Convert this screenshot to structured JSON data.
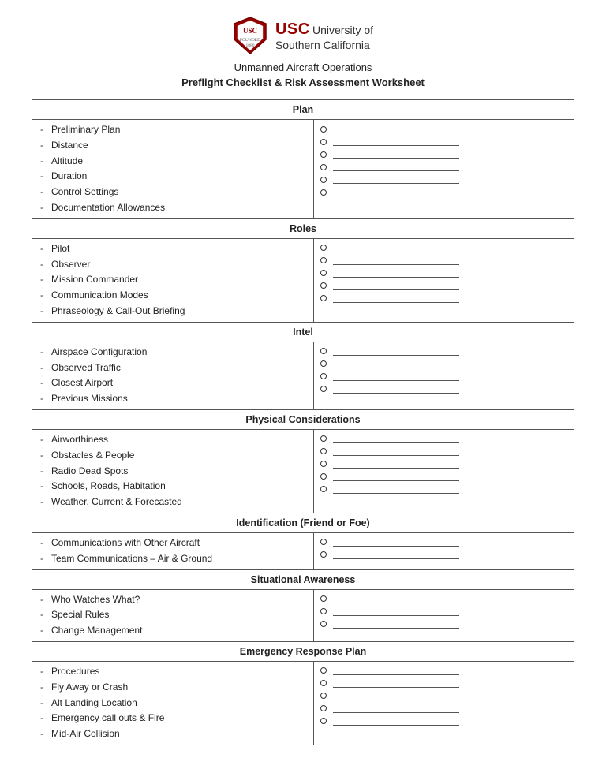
{
  "header": {
    "usc_bold": "USC",
    "usc_name1": "University of",
    "usc_name2": "Southern California",
    "doc_title": "Unmanned Aircraft Operations",
    "doc_subtitle": "Preflight Checklist & Risk Assessment Worksheet"
  },
  "sections": [
    {
      "title": "Plan",
      "items": [
        "Preliminary Plan",
        "Distance",
        "Altitude",
        "Duration",
        "Control Settings",
        "Documentation Allowances"
      ]
    },
    {
      "title": "Roles",
      "items": [
        "Pilot",
        "Observer",
        "Mission Commander",
        "Communication Modes",
        "Phraseology & Call-Out Briefing"
      ]
    },
    {
      "title": "Intel",
      "items": [
        "Airspace Configuration",
        "Observed Traffic",
        "Closest Airport",
        "Previous Missions"
      ]
    },
    {
      "title": "Physical Considerations",
      "items": [
        "Airworthiness",
        "Obstacles & People",
        "Radio Dead Spots",
        "Schools, Roads, Habitation",
        "Weather, Current & Forecasted"
      ]
    },
    {
      "title": "Identification (Friend or Foe)",
      "items": [
        "Communications with Other Aircraft",
        "Team Communications – Air & Ground"
      ]
    },
    {
      "title": "Situational Awareness",
      "items": [
        "Who Watches What?",
        "Special Rules",
        "Change Management"
      ]
    },
    {
      "title": "Emergency Response Plan",
      "items": [
        "Procedures",
        "Fly Away or Crash",
        "Alt Landing Location",
        "Emergency call outs & Fire",
        "Mid-Air Collision"
      ]
    }
  ]
}
